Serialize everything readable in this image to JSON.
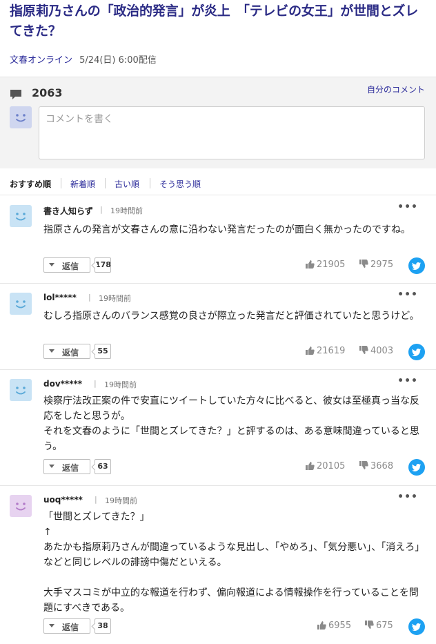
{
  "article": {
    "title": "指原莉乃さんの「政治的発言」が炎上　「テレビの女王」が世間とズレてきた？",
    "source": "文春オンライン",
    "date": "5/24(日) 6:00配信"
  },
  "comments_box": {
    "count": "2063",
    "my_comments_label": "自分のコメント",
    "input_placeholder": "コメントを書く"
  },
  "sort_tabs": [
    "おすすめ順",
    "新着順",
    "古い順",
    "そう思う順"
  ],
  "reply_label": "返信",
  "comments": [
    {
      "user": "書き人知らず",
      "time": "19時間前",
      "body": "指原さんの発言が文春さんの意に沿わない発言だったのが面白く無かったのですね。",
      "replies": "178",
      "likes": "21905",
      "dislikes": "2975",
      "avatar_color": "#c9e3f5"
    },
    {
      "user": "lol*****",
      "time": "19時間前",
      "body": "むしろ指原さんのバランス感覚の良さが際立った発言だと評価されていたと思うけど。",
      "replies": "55",
      "likes": "21619",
      "dislikes": "4003",
      "avatar_color": "#c9e3f5"
    },
    {
      "user": "dov*****",
      "time": "19時間前",
      "body": "検察庁法改正案の件で安直にツイートしていた方々に比べると、彼女は至極真っ当な反応をしたと思うが。\nそれを文春のように「世間とズレてきた？」と評するのは、ある意味間違っていると思う。",
      "replies": "63",
      "likes": "20105",
      "dislikes": "3668",
      "avatar_color": "#c9e3f5"
    },
    {
      "user": "uoq*****",
      "time": "19時間前",
      "body": "「世間とズレてきた？」\n↑\nあたかも指原莉乃さんが間違っているような見出し、「やめろ」、「気分悪い」、「消えろ」などと同じレベルの誹謗中傷だといえる。\n\n大手マスコミが中立的な報道を行わず、偏向報道による情報操作を行っていることを問題にすべきである。",
      "replies": "38",
      "likes": "6955",
      "dislikes": "675",
      "avatar_color": "#e7d3f0"
    }
  ],
  "colors": {
    "title": "#2b2b85",
    "link": "#2b2b9a",
    "twitter": "#1da1f2",
    "avatar_face": "#5aa9d8",
    "avatar_face_purple": "#b37cc9"
  }
}
